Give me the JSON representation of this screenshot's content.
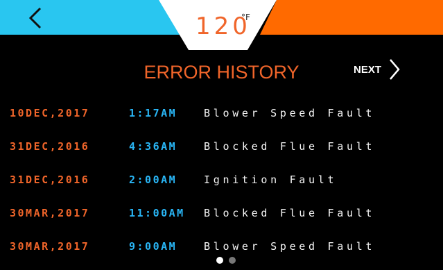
{
  "header": {
    "temperature": "120",
    "unit": "°F",
    "left_color": "#29c6f0",
    "right_color": "#ff6a00"
  },
  "title": "ERROR HISTORY",
  "next_label": "NEXT",
  "errors": [
    {
      "date": "10DEC,2017",
      "time": "1:17AM",
      "message": "Blower Speed Fault"
    },
    {
      "date": "31DEC,2016",
      "time": "4:36AM",
      "message": "Blocked Flue Fault"
    },
    {
      "date": "31DEC,2016",
      "time": "2:00AM",
      "message": "Ignition Fault"
    },
    {
      "date": "30MAR,2017",
      "time": "11:00AM",
      "message": "Blocked Flue Fault"
    },
    {
      "date": "30MAR,2017",
      "time": "9:00AM",
      "message": "Blower Speed Fault"
    }
  ],
  "pager": {
    "pages": 2,
    "current": 1
  },
  "icons": {
    "back": "chevron-left-icon",
    "next": "chevron-right-icon"
  }
}
